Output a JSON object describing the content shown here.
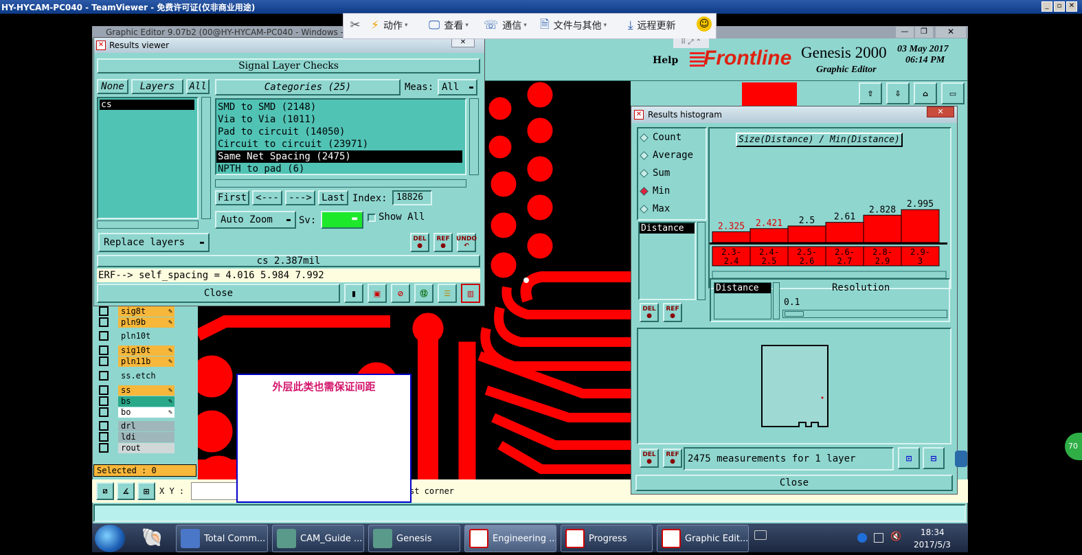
{
  "tv": {
    "title": "HY-HYCAM-PC040 - TeamViewer - 免费许可证(仅非商业用途)",
    "toolbar": [
      {
        "label": "动作",
        "icon": "lightning-icon"
      },
      {
        "label": "查看",
        "icon": "monitor-icon"
      },
      {
        "label": "通信",
        "icon": "phone-icon"
      },
      {
        "label": "文件与其他",
        "icon": "file-icon"
      },
      {
        "label": "远程更新",
        "icon": "download-icon"
      }
    ]
  },
  "editor": {
    "title": "Graphic Editor 9.07b2 (00@HY-HYCAM-PC040 - Windows - n",
    "help": "Help",
    "brand": "Frontline",
    "product": "Genesis 2000",
    "subtitle": "Graphic Editor",
    "date": "03 May 2017",
    "time": "06:14 PM",
    "xy_label": "X Y :",
    "status_msg": "st corner",
    "selected": "Selected : 0"
  },
  "layers": [
    {
      "name": "sig8t",
      "color": "#f7b73a",
      "icon": "✎"
    },
    {
      "name": "pln9b",
      "color": "#f7b73a",
      "icon": "✎"
    },
    {
      "name": "pln10t",
      "color": "#8fd6cf",
      "icon": ""
    },
    {
      "name": "sig10t",
      "color": "#f7b73a",
      "icon": "✎"
    },
    {
      "name": "pln11b",
      "color": "#f7b73a",
      "icon": "✎"
    },
    {
      "name": "ss.etch",
      "color": "#8fd6cf",
      "icon": ""
    },
    {
      "name": "ss",
      "color": "#f7b73a",
      "icon": "✎"
    },
    {
      "name": "bs",
      "color": "#2aa88a",
      "icon": "✎"
    },
    {
      "name": "bo",
      "color": "#ffffff",
      "icon": "✎"
    },
    {
      "name": "drl",
      "color": "#9fb7bb",
      "icon": ""
    },
    {
      "name": "ldi",
      "color": "#9fb7bb",
      "icon": ""
    },
    {
      "name": "rout",
      "color": "#d0d8d8",
      "icon": ""
    }
  ],
  "results": {
    "title": "Results viewer",
    "header": "Signal Layer Checks",
    "none": "None",
    "layers": "Layers",
    "all": "All",
    "categories": "Categories (25)",
    "meas_label": "Meas:",
    "meas_value": "All",
    "layer_items": [
      "cs"
    ],
    "category_items": [
      "SMD to SMD (2148)",
      "Via to Via (1011)",
      "Pad to circuit (14050)",
      "Circuit to circuit (23971)",
      "Same Net Spacing (2475)",
      "NPTH to pad (6)"
    ],
    "selected_index": 4,
    "first": "First",
    "prev": "<---",
    "next": "--->",
    "last": "Last",
    "index_label": "Index:",
    "index_value": "18826",
    "auto_zoom": "Auto Zoom",
    "sv_label": "Sv:",
    "show_all": "Show All",
    "replace": "Replace layers",
    "del": "DEL",
    "ref": "REF",
    "undo": "UNDO",
    "info": "cs 2.387mil",
    "erf": "ERF--> self_spacing = 4.016 5.984 7.992",
    "close": "Close"
  },
  "histogram": {
    "title": "Results histogram",
    "options": [
      "Count",
      "Average",
      "Sum",
      "Min",
      "Max"
    ],
    "selected_option": 3,
    "metric_title": "Size(Distance) / Min(Distance)",
    "distance": "Distance",
    "distance2": "Distance",
    "resolution_label": "Resolution",
    "resolution_value": "0.1",
    "del": "DEL",
    "ref": "REF",
    "measurements": "2475 measurements for 1 layer",
    "close": "Close"
  },
  "chart_data": {
    "type": "bar",
    "categories": [
      "2.3-\n2.4",
      "2.4-\n2.5",
      "2.5-\n2.6",
      "2.6-\n2.7",
      "2.8-\n2.9",
      "2.9-\n3"
    ],
    "values": [
      2.325,
      2.421,
      2.5,
      2.61,
      2.828,
      2.995
    ],
    "value_labels": [
      "2.325",
      "2.421",
      "2.5",
      "2.61",
      "2.828",
      "2.995"
    ],
    "label_colors": [
      "#e00000",
      "#e00000",
      "#000000",
      "#000000",
      "#000000",
      "#000000"
    ],
    "title": "Size(Distance) / Min(Distance)",
    "ylim": [
      2.0,
      3.0
    ]
  },
  "annotation": {
    "text": "外层此类也需保证间距"
  },
  "taskbar": {
    "items": [
      "Total Comm...",
      "CAM_Guide ...",
      "Genesis",
      "Engineering ...",
      "Progress",
      "Graphic Edit..."
    ],
    "active_index": 3,
    "time": "18:34",
    "date": "2017/5/3",
    "edge_badge": "70"
  },
  "colors": {
    "teal": "#8fd6cf",
    "teal_dark": "#51c3b5",
    "pcb_red": "#ff0000",
    "titlebar": "#0a246a"
  }
}
